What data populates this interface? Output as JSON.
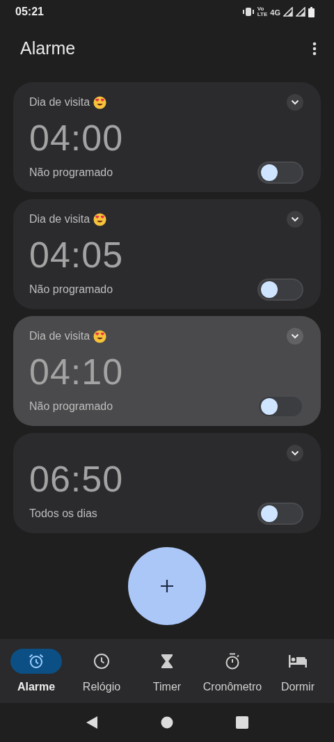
{
  "status_bar": {
    "time": "05:21",
    "volte_top": "Vo",
    "volte_bottom": "LTE",
    "network": "4G"
  },
  "app_bar": {
    "title": "Alarme"
  },
  "alarms": [
    {
      "label": "Dia de visita",
      "emoji": true,
      "time": "04:00",
      "schedule": "Não programado",
      "on": false,
      "selected": false
    },
    {
      "label": "Dia de visita",
      "emoji": true,
      "time": "04:05",
      "schedule": "Não programado",
      "on": false,
      "selected": false
    },
    {
      "label": "Dia de visita",
      "emoji": true,
      "time": "04:10",
      "schedule": "Não programado",
      "on": false,
      "selected": true
    },
    {
      "time": "06:50",
      "schedule": "Todos os dias",
      "on": false,
      "selected": false
    }
  ],
  "nav": [
    {
      "kind": "alarm",
      "label": "Alarme",
      "selected": true
    },
    {
      "kind": "clock",
      "label": "Relógio",
      "selected": false
    },
    {
      "kind": "timer",
      "label": "Timer",
      "selected": false
    },
    {
      "kind": "stopwatch",
      "label": "Cronômetro",
      "selected": false
    },
    {
      "kind": "sleep",
      "label": "Dormir",
      "selected": false
    }
  ]
}
